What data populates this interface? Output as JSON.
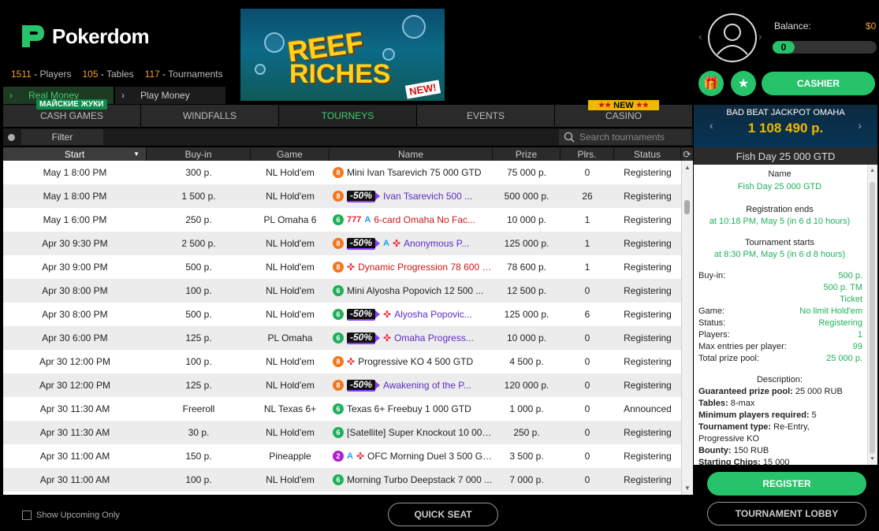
{
  "brand": {
    "name": "Pokerdom"
  },
  "stats": [
    {
      "value": "1511",
      "label": "Players"
    },
    {
      "value": "105",
      "label": "Tables"
    },
    {
      "value": "117",
      "label": "Tournaments"
    }
  ],
  "banner": {
    "line1": "REEF",
    "line2": "RICHES",
    "badge": "NEW!"
  },
  "money_tabs": {
    "real": "Real Money",
    "play": "Play Money",
    "promo": "МАЙСКИЕ ЖУКИ"
  },
  "account": {
    "balance_label": "Balance:",
    "currency": "$0",
    "balance_value": "0",
    "cashier": "CASHIER"
  },
  "main_tabs": [
    "CASH GAMES",
    "WINDFALLS",
    "TOURNEYS",
    "EVENTS",
    "CASINO"
  ],
  "casino_badge": "NEW",
  "filter": {
    "label": "Filter",
    "search_placeholder": "Search tournaments"
  },
  "columns": [
    "Start",
    "Buy-in",
    "Game",
    "Name",
    "Prize",
    "Plrs.",
    "Status"
  ],
  "rows": [
    {
      "start": "May 1 8:00 PM",
      "buyin": "300 p.",
      "game": "NL Hold'em",
      "num": "8",
      "numColor": "#f07820",
      "disc": "",
      "ab": "",
      "ko": false,
      "t777": false,
      "name": "Mini Ivan Tsarevich 75 000 GTD",
      "nameStyle": "",
      "prize": "75 000 p.",
      "plrs": "0",
      "status": "Registering"
    },
    {
      "start": "May 1 8:00 PM",
      "buyin": "1 500 p.",
      "game": "NL Hold'em",
      "num": "8",
      "numColor": "#f07820",
      "disc": "-50%",
      "ab": "",
      "ko": false,
      "t777": false,
      "name": "Ivan Tsarevich 500 ...",
      "nameStyle": "purple",
      "prize": "500 000 p.",
      "plrs": "26",
      "status": "Registering"
    },
    {
      "start": "May 1 6:00 PM",
      "buyin": "250 p.",
      "game": "PL Omaha 6",
      "num": "6",
      "numColor": "#1fb05a",
      "disc": "",
      "ab": "A",
      "ko": false,
      "t777": true,
      "name": "6-card Omaha No Fac...",
      "nameStyle": "red",
      "prize": "10 000 p.",
      "plrs": "1",
      "status": "Registering"
    },
    {
      "start": "Apr 30 9:30 PM",
      "buyin": "2 500 p.",
      "game": "NL Hold'em",
      "num": "8",
      "numColor": "#f07820",
      "disc": "-50%",
      "ab": "A",
      "ko": true,
      "t777": false,
      "name": "Anonymous P...",
      "nameStyle": "purple",
      "prize": "125 000 p.",
      "plrs": "1",
      "status": "Registering"
    },
    {
      "start": "Apr 30 9:00 PM",
      "buyin": "500 p.",
      "game": "NL Hold'em",
      "num": "8",
      "numColor": "#f07820",
      "disc": "",
      "ab": "",
      "ko": true,
      "t777": false,
      "name": "Dynamic Progression 78 600 G...",
      "nameStyle": "red",
      "prize": "78 600 p.",
      "plrs": "1",
      "status": "Registering"
    },
    {
      "start": "Apr 30 8:00 PM",
      "buyin": "100 p.",
      "game": "NL Hold'em",
      "num": "6",
      "numColor": "#1fb05a",
      "disc": "",
      "ab": "",
      "ko": false,
      "t777": false,
      "name": "Mini Alyosha Popovich 12 500 ...",
      "nameStyle": "",
      "prize": "12 500 p.",
      "plrs": "0",
      "status": "Registering"
    },
    {
      "start": "Apr 30 8:00 PM",
      "buyin": "500 p.",
      "game": "NL Hold'em",
      "num": "6",
      "numColor": "#1fb05a",
      "disc": "-50%",
      "ab": "",
      "ko": true,
      "t777": false,
      "name": "Alyosha Popovic...",
      "nameStyle": "purple",
      "prize": "125 000 p.",
      "plrs": "6",
      "status": "Registering"
    },
    {
      "start": "Apr 30 6:00 PM",
      "buyin": "125 p.",
      "game": "PL Omaha",
      "num": "6",
      "numColor": "#1fb05a",
      "disc": "-50%",
      "ab": "",
      "ko": true,
      "t777": false,
      "name": "Omaha Progress...",
      "nameStyle": "purple",
      "prize": "10 000 p.",
      "plrs": "0",
      "status": "Registering"
    },
    {
      "start": "Apr 30 12:00 PM",
      "buyin": "100 p.",
      "game": "NL Hold'em",
      "num": "8",
      "numColor": "#f07820",
      "disc": "",
      "ab": "",
      "ko": true,
      "t777": false,
      "name": "Progressive KO 4 500 GTD",
      "nameStyle": "",
      "prize": "4 500 p.",
      "plrs": "0",
      "status": "Registering"
    },
    {
      "start": "Apr 30 12:00 PM",
      "buyin": "125 p.",
      "game": "NL Hold'em",
      "num": "8",
      "numColor": "#f07820",
      "disc": "-50%",
      "ab": "",
      "ko": false,
      "t777": false,
      "name": "Awakening of the P...",
      "nameStyle": "purple",
      "prize": "120 000 p.",
      "plrs": "0",
      "status": "Registering"
    },
    {
      "start": "Apr 30 11:30 AM",
      "buyin": "Freeroll",
      "game": "NL Texas 6+",
      "num": "6",
      "numColor": "#1fb05a",
      "disc": "",
      "ab": "",
      "ko": false,
      "t777": false,
      "name": "Texas 6+ Freebuy 1 000 GTD",
      "nameStyle": "",
      "prize": "1 000 p.",
      "plrs": "0",
      "status": "Announced"
    },
    {
      "start": "Apr 30 11:30 AM",
      "buyin": "30 p.",
      "game": "NL Hold'em",
      "num": "6",
      "numColor": "#1fb05a",
      "disc": "",
      "ab": "",
      "ko": false,
      "t777": false,
      "name": "[Satellite] Super Knockout 10 000...",
      "nameStyle": "",
      "prize": "250 p.",
      "plrs": "0",
      "status": "Registering"
    },
    {
      "start": "Apr 30 11:00 AM",
      "buyin": "150 p.",
      "game": "Pineapple",
      "num": "2",
      "numColor": "#b020d0",
      "disc": "",
      "ab": "A",
      "ko": true,
      "t777": false,
      "name": "OFC Morning Duel 3 500 GTD",
      "nameStyle": "",
      "prize": "3 500 p.",
      "plrs": "0",
      "status": "Registering"
    },
    {
      "start": "Apr 30 11:00 AM",
      "buyin": "100 p.",
      "game": "NL Hold'em",
      "num": "6",
      "numColor": "#1fb05a",
      "disc": "",
      "ab": "",
      "ko": false,
      "t777": false,
      "name": "Morning Turbo Deepstack 7 000 ...",
      "nameStyle": "",
      "prize": "7 000 p.",
      "plrs": "0",
      "status": "Registering"
    }
  ],
  "bottom": {
    "show_upcoming": "Show Upcoming Only",
    "quick_seat": "QUICK SEAT"
  },
  "jackpot": {
    "title": "BAD BEAT JACKPOT OMAHA",
    "value": "1 108 490 р."
  },
  "detail": {
    "header": "Fish Day 25 000 GTD",
    "name_label": "Name",
    "name_value": "Fish Day 25 000 GTD",
    "reg_ends_label": "Registration ends",
    "reg_ends_value": "at 10:18 PM, May 5 (in 6 d 10 hours)",
    "starts_label": "Tournament starts",
    "starts_value": "at 8:30 PM, May 5 (in 6 d 8 hours)",
    "buyin_label": "Buy-in:",
    "buyin_v1": "500 р.",
    "buyin_v2": "500 р. TM",
    "buyin_v3": "Ticket",
    "game_label": "Game:",
    "game_value": "No limit Hold'em",
    "status_label": "Status:",
    "status_value": "Registering",
    "players_label": "Players:",
    "players_value": "1",
    "maxentries_label": "Max entries per player:",
    "maxentries_value": "99",
    "prizepool_label": "Total prize pool:",
    "prizepool_value": "25 000 р.",
    "desc_label": "Description:",
    "d1k": "Guaranteed prize pool:",
    "d1v": " 25 000 RUB",
    "d2k": "Tables:",
    "d2v": " 8-max",
    "d3k": "Minimum players required:",
    "d3v": " 5",
    "d4k": "Tournament type:",
    "d4v": " Re-Entry, Progressive KO",
    "d5k": "Bounty:",
    "d5v": " 150 RUB",
    "d6k": "Starting Chips:",
    "d6v": " 15 000"
  },
  "actions": {
    "register": "REGISTER",
    "lobby": "TOURNAMENT LOBBY"
  },
  "colors": {
    "accent": "#27c36a",
    "orange": "#f0a030",
    "gold": "#f0b800"
  }
}
